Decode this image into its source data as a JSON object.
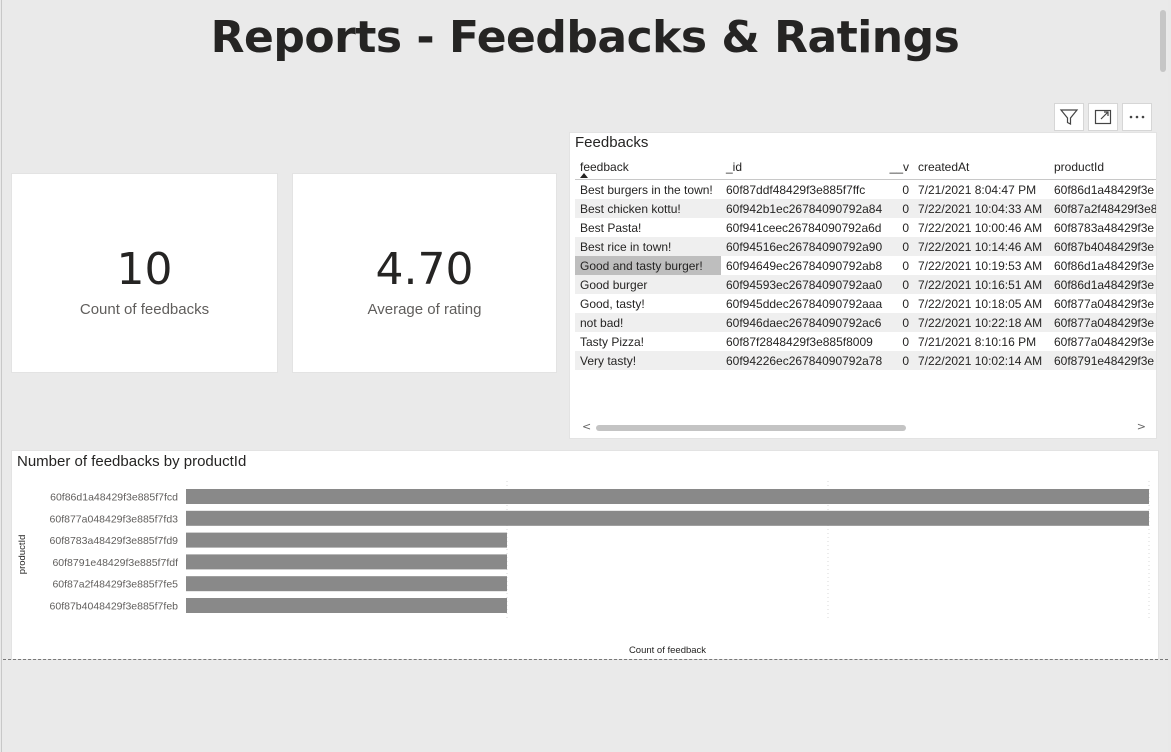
{
  "page": {
    "title": "Reports - Feedbacks & Ratings"
  },
  "kpis": [
    {
      "value": "10",
      "label": "Count of feedbacks"
    },
    {
      "value": "4.70",
      "label": "Average of rating"
    }
  ],
  "visual_toolbar": {
    "icons": [
      "filter-icon",
      "focus-mode-icon",
      "more-options-icon"
    ]
  },
  "table": {
    "title": "Feedbacks",
    "columns": [
      "feedback",
      "_id",
      "__v",
      "createdAt",
      "productId"
    ],
    "sorted_column": "feedback",
    "rows": [
      [
        "Best burgers in the town!",
        "60f87ddf48429f3e885f7ffc",
        "0",
        "7/21/2021 8:04:47 PM",
        "60f86d1a48429f3e"
      ],
      [
        "Best chicken kottu!",
        "60f942b1ec26784090792a84",
        "0",
        "7/22/2021 10:04:33 AM",
        "60f87a2f48429f3e8"
      ],
      [
        "Best Pasta!",
        "60f941ceec26784090792a6d",
        "0",
        "7/22/2021 10:00:46 AM",
        "60f8783a48429f3e"
      ],
      [
        "Best rice in town!",
        "60f94516ec26784090792a90",
        "0",
        "7/22/2021 10:14:46 AM",
        "60f87b4048429f3e"
      ],
      [
        "Good and tasty burger!",
        "60f94649ec26784090792ab8",
        "0",
        "7/22/2021 10:19:53 AM",
        "60f86d1a48429f3e"
      ],
      [
        "Good burger",
        "60f94593ec26784090792aa0",
        "0",
        "7/22/2021 10:16:51 AM",
        "60f86d1a48429f3e"
      ],
      [
        "Good, tasty!",
        "60f945ddec26784090792aaa",
        "0",
        "7/22/2021 10:18:05 AM",
        "60f877a048429f3e"
      ],
      [
        "not bad!",
        "60f946daec26784090792ac6",
        "0",
        "7/22/2021 10:22:18 AM",
        "60f877a048429f3e"
      ],
      [
        "Tasty Pizza!",
        "60f87f2848429f3e885f8009",
        "0",
        "7/21/2021 8:10:16 PM",
        "60f877a048429f3e"
      ],
      [
        "Very tasty!",
        "60f94226ec26784090792a78",
        "0",
        "7/22/2021 10:02:14 AM",
        "60f8791e48429f3e"
      ]
    ],
    "selected_cell": {
      "row": 4,
      "col": 0
    },
    "scroll_left_glyph": "<",
    "scroll_right_glyph": ">"
  },
  "chart_data": {
    "type": "bar",
    "orientation": "horizontal",
    "title": "Number of feedbacks by productId",
    "xlabel": "Count of feedback",
    "ylabel": "productId",
    "categories": [
      "60f86d1a48429f3e885f7fcd",
      "60f877a048429f3e885f7fd3",
      "60f8783a48429f3e885f7fd9",
      "60f8791e48429f3e885f7fdf",
      "60f87a2f48429f3e885f7fe5",
      "60f87b4048429f3e885f7feb"
    ],
    "values": [
      3,
      3,
      1,
      1,
      1,
      1
    ],
    "xlim": [
      0,
      3
    ],
    "xticks": [
      0,
      1,
      2,
      3
    ],
    "grid": true,
    "bar_color": "#898989"
  }
}
